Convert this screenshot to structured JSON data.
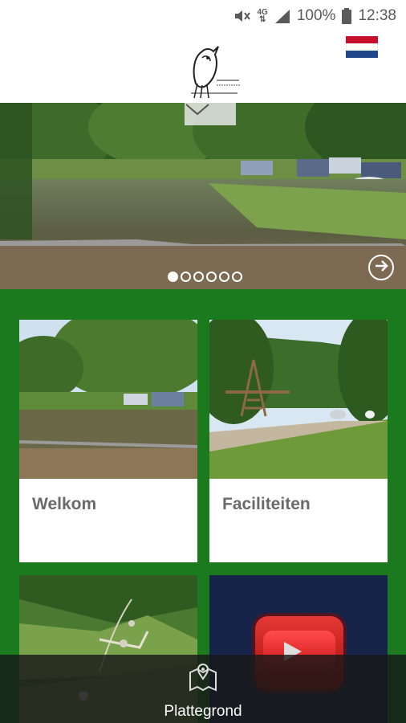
{
  "status_bar": {
    "network_type": "4G",
    "battery_percent": "100%",
    "time": "12:38",
    "icons": [
      "mute-icon",
      "network-4g-icon",
      "signal-icon",
      "battery-icon"
    ]
  },
  "header": {
    "language_flag": "nl-flag"
  },
  "hero": {
    "slides_total": 6,
    "active_slide": 1,
    "icons": [
      "chevron-down-icon",
      "arrow-right-circle-icon"
    ]
  },
  "tiles": [
    {
      "label": "Welkom"
    },
    {
      "label": "Faciliteiten"
    },
    {
      "label": ""
    },
    {
      "label": ""
    }
  ],
  "bottom_bar": {
    "label": "Plattegrond",
    "icon": "map-pin-icon"
  },
  "colors": {
    "green": "#1b7a1e",
    "video_bg": "#16244a",
    "youtube_red": "#e53935"
  }
}
